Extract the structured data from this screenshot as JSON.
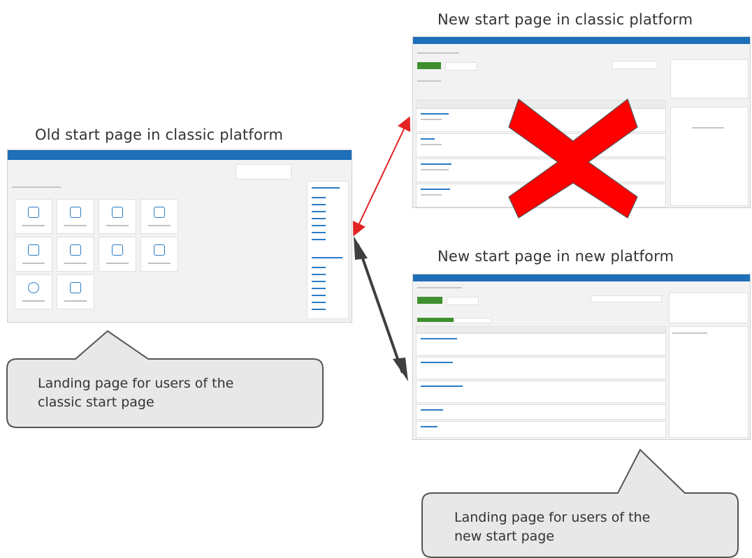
{
  "captions": {
    "old_classic": "Old start page in classic platform",
    "new_classic": "New start page in classic platform",
    "new_new": "New start page in new  platform"
  },
  "bubbles": {
    "classic": "Landing page for users of the\nclassic start page",
    "new": "Landing page for users of the\nnew  start page"
  },
  "colors": {
    "header_blue": "#1d6fb8",
    "accent_green": "#3f8f2f",
    "cross_red": "#ff0000",
    "arrow_red": "#e32222",
    "arrow_dark": "#3f3f3f",
    "bubble_fill": "#e8e8e8"
  },
  "icons": [
    "red-cross-icon"
  ]
}
